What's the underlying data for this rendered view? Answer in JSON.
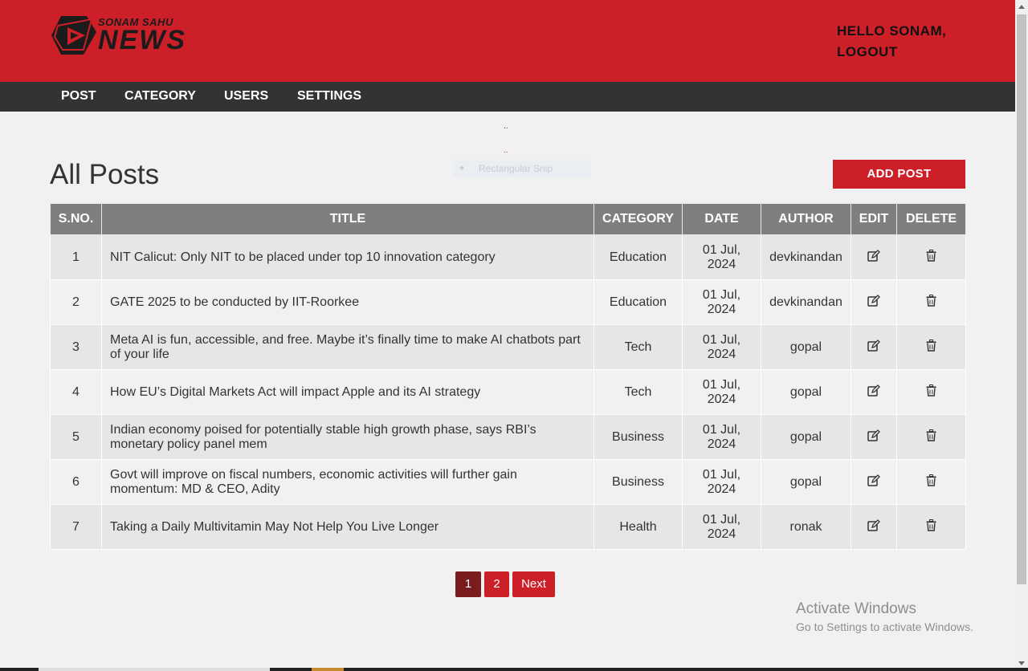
{
  "header": {
    "logo_small": "SONAM SAHU",
    "logo_big": "NEWS",
    "hello": "HELLO SONAM,",
    "logout": "LOGOUT",
    "bg_color": "#cd1f28"
  },
  "nav": {
    "items": [
      {
        "label": "POST"
      },
      {
        "label": "CATEGORY"
      },
      {
        "label": "USERS"
      },
      {
        "label": "SETTINGS"
      }
    ]
  },
  "overlay": {
    "dots_top": "..",
    "dots_bottom": "..",
    "snip_label": "Rectangular Snip"
  },
  "main": {
    "title": "All Posts",
    "add_post_label": "ADD POST",
    "columns": [
      "S.NO.",
      "TITLE",
      "CATEGORY",
      "DATE",
      "AUTHOR",
      "EDIT",
      "DELETE"
    ],
    "rows": [
      {
        "sno": "1",
        "title": "NIT Calicut: Only NIT to be placed under top 10 innovation category",
        "category": "Education",
        "date": "01 Jul, 2024",
        "author": "devkinandan"
      },
      {
        "sno": "2",
        "title": "GATE 2025 to be conducted by IIT-Roorkee",
        "category": "Education",
        "date": "01 Jul, 2024",
        "author": "devkinandan"
      },
      {
        "sno": "3",
        "title": "Meta AI is fun, accessible, and free. Maybe it’s finally time to make AI chatbots part of your life",
        "category": "Tech",
        "date": "01 Jul, 2024",
        "author": "gopal"
      },
      {
        "sno": "4",
        "title": "How EU’s Digital Markets Act will impact Apple and its AI strategy",
        "category": "Tech",
        "date": "01 Jul, 2024",
        "author": "gopal"
      },
      {
        "sno": "5",
        "title": "Indian economy poised for potentially stable high growth phase, says RBI’s monetary policy panel mem",
        "category": "Business",
        "date": "01 Jul, 2024",
        "author": "gopal"
      },
      {
        "sno": "6",
        "title": "Govt will improve on fiscal numbers, economic activities will further gain momentum: MD & CEO, Adity",
        "category": "Business",
        "date": "01 Jul, 2024",
        "author": "gopal"
      },
      {
        "sno": "7",
        "title": "Taking a Daily Multivitamin May Not Help You Live Longer",
        "category": "Health",
        "date": "01 Jul, 2024",
        "author": "ronak"
      }
    ],
    "edit_icon": "edit-icon",
    "delete_icon": "trash-icon"
  },
  "pagination": {
    "pages": [
      "1",
      "2"
    ],
    "active": "1",
    "next_label": "Next",
    "active_color": "#7a1c1e",
    "color": "#cd1f28"
  },
  "watermark": {
    "line1": "Activate Windows",
    "line2": "Go to Settings to activate Windows."
  }
}
